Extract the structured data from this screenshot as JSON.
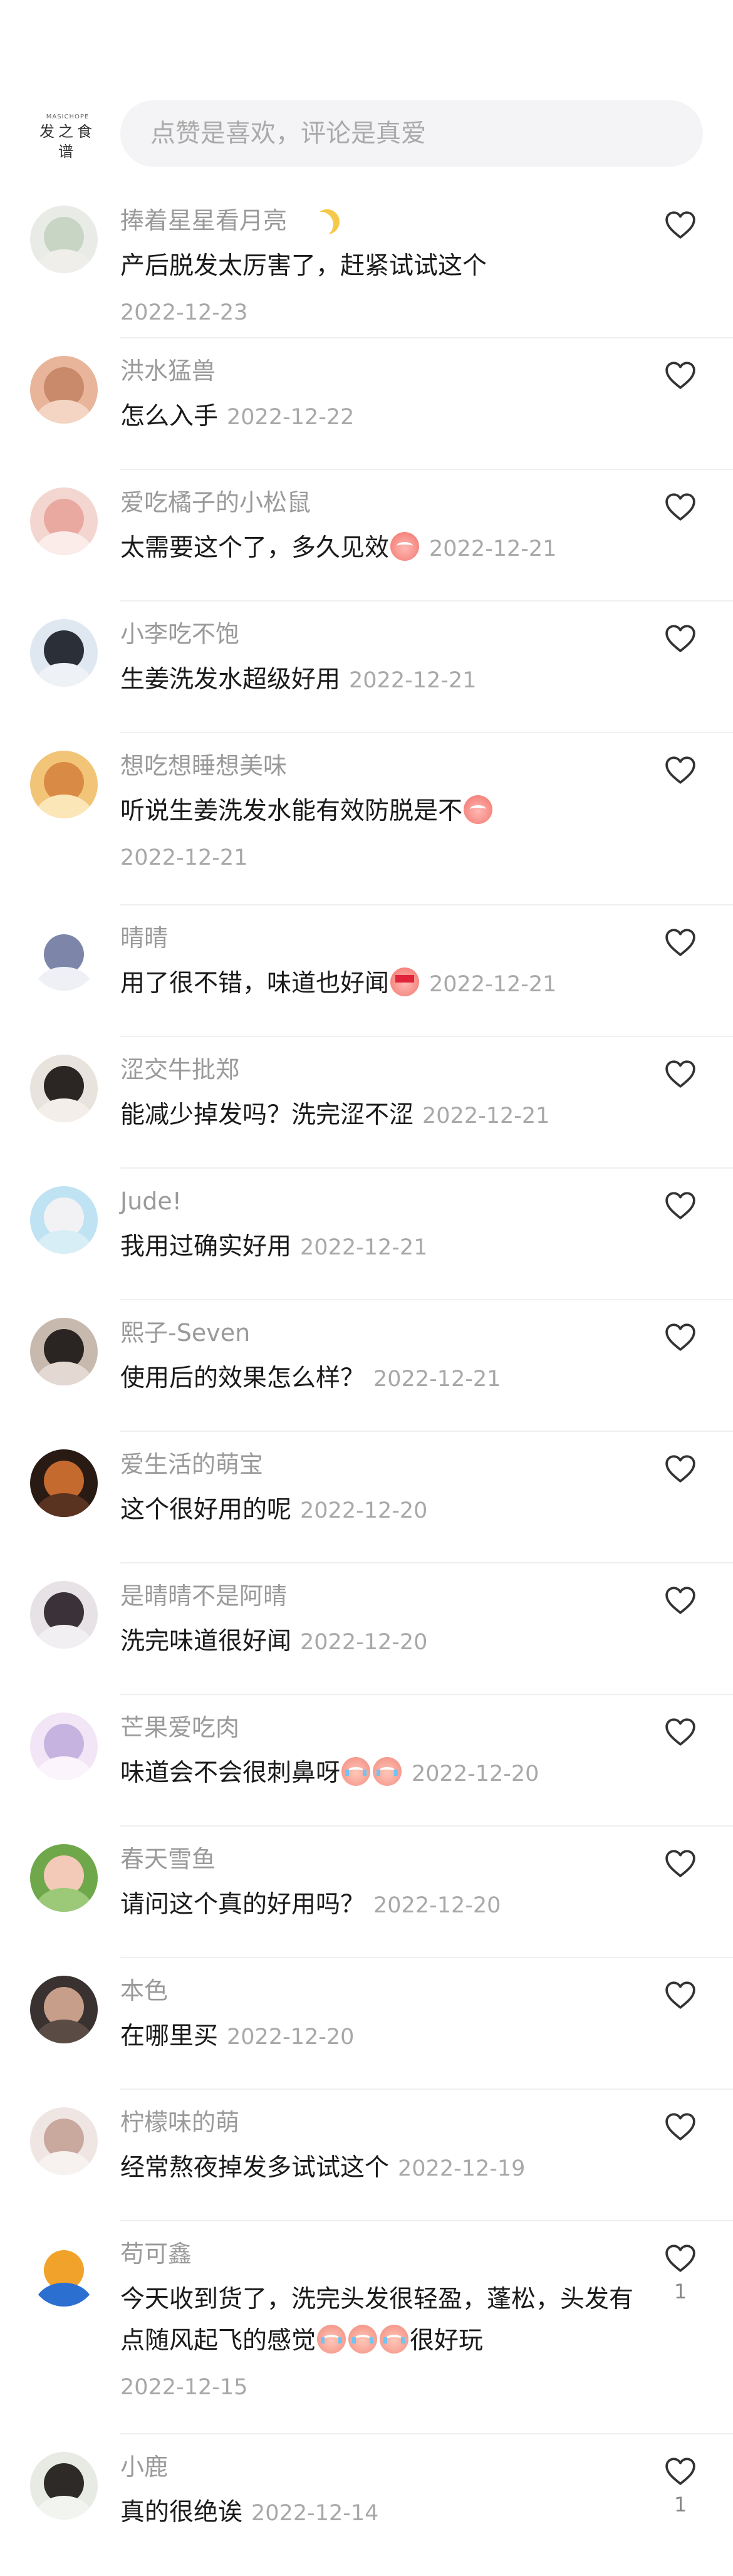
{
  "header": {
    "logo_small": "MASICHOPE",
    "logo_main": "发之食谱",
    "search_placeholder": "点赞是喜欢，评论是真爱"
  },
  "comments": [
    {
      "name": "捧着星星看月亮",
      "text": "产后脱发太厉害了，赶紧试试这个",
      "date": "2022-12-23",
      "likes": "",
      "avatar_colors": [
        "#e9ece6",
        "#c9d5c4",
        "#f0eeea"
      ],
      "emojis": []
    },
    {
      "name": "洪水猛兽",
      "text": "怎么入手",
      "date": "2022-12-22",
      "likes": "",
      "avatar_colors": [
        "#e8b49a",
        "#c98a6c",
        "#f4d5c4"
      ],
      "emojis": []
    },
    {
      "name": "爱吃橘子的小松鼠",
      "text": "太需要这个了，多久见效",
      "date": "2022-12-21",
      "likes": "",
      "avatar_colors": [
        "#f3d6d0",
        "#e9a9a0",
        "#fbecea"
      ],
      "emojis": [
        "smile"
      ]
    },
    {
      "name": "小李吃不饱",
      "text": "生姜洗发水超级好用",
      "date": "2022-12-21",
      "likes": "",
      "avatar_colors": [
        "#dfe7f0",
        "#2a2f38",
        "#eef2f6"
      ],
      "emojis": []
    },
    {
      "name": "想吃想睡想美味",
      "text": "听说生姜洗发水能有效防脱是不",
      "date": "2022-12-21",
      "likes": "",
      "avatar_colors": [
        "#f2c478",
        "#d98a45",
        "#fbe6b8"
      ],
      "emojis": [
        "smile"
      ]
    },
    {
      "name": "晴晴",
      "text": "用了很不错，味道也好闻",
      "date": "2022-12-21",
      "likes": "",
      "avatar_colors": [
        "#ffffff",
        "#7d86a8",
        "#eef0f6"
      ],
      "emojis": [
        "love"
      ]
    },
    {
      "name": "涩交牛批郑",
      "text": "能减少掉发吗？洗完涩不涩",
      "date": "2022-12-21",
      "likes": "",
      "avatar_colors": [
        "#e9e3de",
        "#2b2523",
        "#f3eeea"
      ],
      "emojis": []
    },
    {
      "name": "Jude!",
      "text": "我用过确实好用",
      "date": "2022-12-21",
      "likes": "",
      "avatar_colors": [
        "#bfe3f3",
        "#f2f2f4",
        "#d8eef7"
      ],
      "emojis": []
    },
    {
      "name": "熙子-Seven",
      "text": "使用后的效果怎么样？",
      "date": "2022-12-21",
      "likes": "",
      "avatar_colors": [
        "#c8b9ae",
        "#2a2422",
        "#e3d9d2"
      ],
      "emojis": []
    },
    {
      "name": "爱生活的萌宝",
      "text": "这个很好用的呢",
      "date": "2022-12-20",
      "likes": "",
      "avatar_colors": [
        "#2a1a14",
        "#c46a2e",
        "#5a3220"
      ],
      "emojis": []
    },
    {
      "name": "是晴晴不是阿晴",
      "text": "洗完味道很好闻",
      "date": "2022-12-20",
      "likes": "",
      "avatar_colors": [
        "#e6e2e6",
        "#3a3238",
        "#f2eff2"
      ],
      "emojis": []
    },
    {
      "name": "芒果爱吃肉",
      "text": "味道会不会很刺鼻呀",
      "date": "2022-12-20",
      "likes": "",
      "avatar_colors": [
        "#f2e6f6",
        "#c7b3e0",
        "#fbf4fc"
      ],
      "emojis": [
        "cry",
        "cry"
      ]
    },
    {
      "name": "春天雪鱼",
      "text": "请问这个真的好用吗？",
      "date": "2022-12-20",
      "likes": "",
      "avatar_colors": [
        "#6fa84a",
        "#f3c9b8",
        "#9cc978"
      ],
      "emojis": []
    },
    {
      "name": "本色",
      "text": "在哪里买",
      "date": "2022-12-20",
      "likes": "",
      "avatar_colors": [
        "#3a3230",
        "#c79e8a",
        "#5b4b45"
      ],
      "emojis": []
    },
    {
      "name": "柠檬味的萌",
      "text": "经常熬夜掉发多试试这个",
      "date": "2022-12-19",
      "likes": "",
      "avatar_colors": [
        "#efe6e4",
        "#c9a89e",
        "#f7f1ef"
      ],
      "emojis": []
    },
    {
      "name": "苟可鑫",
      "text": "今天收到货了，洗完头发很轻盈，蓬松，头发有点随风起飞的感觉",
      "text_tail": "很好玩",
      "date": "2022-12-15",
      "likes": "1",
      "avatar_colors": [
        "#ffffff",
        "#f0a22a",
        "#2b6fd1"
      ],
      "emojis": [
        "cry",
        "cry",
        "cry"
      ]
    },
    {
      "name": "小鹿",
      "text": "真的很绝诶",
      "date": "2022-12-14",
      "likes": "1",
      "avatar_colors": [
        "#e7ebe4",
        "#2d2a28",
        "#f2f4f0"
      ],
      "emojis": []
    }
  ]
}
